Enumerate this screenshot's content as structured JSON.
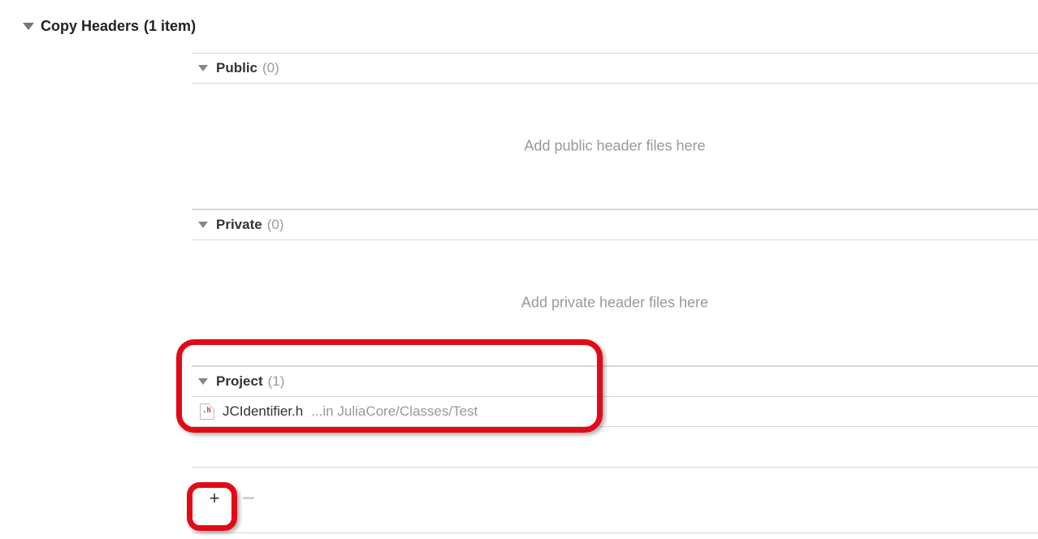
{
  "phase": {
    "label": "Copy Headers",
    "count_text": "(1 item)"
  },
  "sections": {
    "public": {
      "label": "Public",
      "count_text": "(0)",
      "placeholder": "Add public header files here"
    },
    "private": {
      "label": "Private",
      "count_text": "(0)",
      "placeholder": "Add private header files here"
    },
    "project": {
      "label": "Project",
      "count_text": "(1)",
      "files": [
        {
          "name": "JCIdentifier.h",
          "path": "...in JuliaCore/Classes/Test"
        }
      ]
    }
  },
  "toolbar": {
    "plus_label": "+",
    "minus_label": "−"
  }
}
